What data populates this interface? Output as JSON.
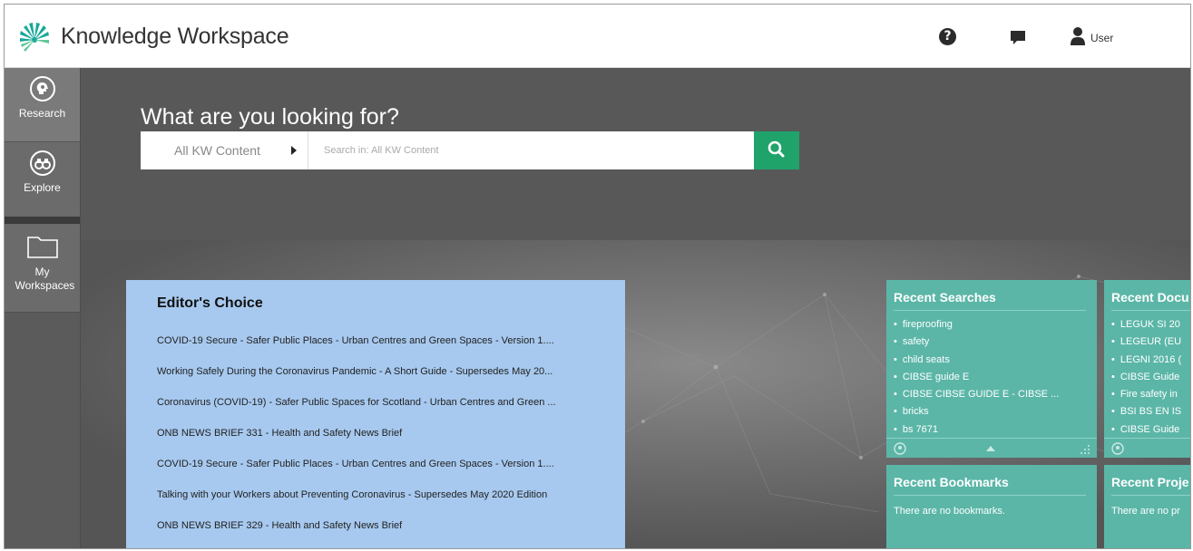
{
  "header": {
    "app_title": "Knowledge Workspace",
    "help_label": "?",
    "user_label": "User"
  },
  "sidebar": {
    "items": [
      {
        "label": "Research",
        "icon": "research-head-icon"
      },
      {
        "label": "Explore",
        "icon": "binoculars-icon"
      },
      {
        "label": "My Workspaces",
        "icon": "folder-icon"
      }
    ]
  },
  "search": {
    "title": "What are you looking for?",
    "scope_label": "All KW Content",
    "placeholder": "Search in: All KW Content",
    "button_color": "#1fa36b"
  },
  "editors_choice": {
    "title": "Editor's Choice",
    "items": [
      "COVID-19 Secure - Safer Public Places - Urban Centres and Green Spaces - Version 1....",
      "Working Safely During the Coronavirus Pandemic - A Short Guide - Supersedes May 20...",
      "Coronavirus (COVID-19) - Safer Public Spaces for Scotland - Urban Centres and Green ...",
      "ONB NEWS BRIEF 331 - Health and Safety News Brief",
      "COVID-19 Secure - Safer Public Places - Urban Centres and Green Spaces - Version 1....",
      "Talking with your Workers about Preventing Coronavirus - Supersedes May 2020 Edition",
      "ONB NEWS BRIEF 329 - Health and Safety News Brief"
    ]
  },
  "recent_searches": {
    "title": "Recent Searches",
    "items": [
      "fireproofing",
      "safety",
      "child seats",
      "CIBSE guide E",
      "CIBSE CIBSE GUIDE E - CIBSE ...",
      "bricks",
      "bs 7671"
    ]
  },
  "recent_documents": {
    "title": "Recent Docu",
    "items": [
      "LEGUK SI 20",
      "LEGEUR (EU",
      "LEGNI 2016 (",
      "CIBSE Guide",
      "Fire safety in",
      "BSI BS EN IS",
      "CIBSE Guide"
    ]
  },
  "recent_bookmarks": {
    "title": "Recent Bookmarks",
    "empty": "There are no bookmarks."
  },
  "recent_projects": {
    "title": "Recent Proje",
    "empty": "There are no pr"
  },
  "colors": {
    "card": "#5bb6a7",
    "editor_panel": "#a7c9ef",
    "accent": "#1fa36b"
  }
}
